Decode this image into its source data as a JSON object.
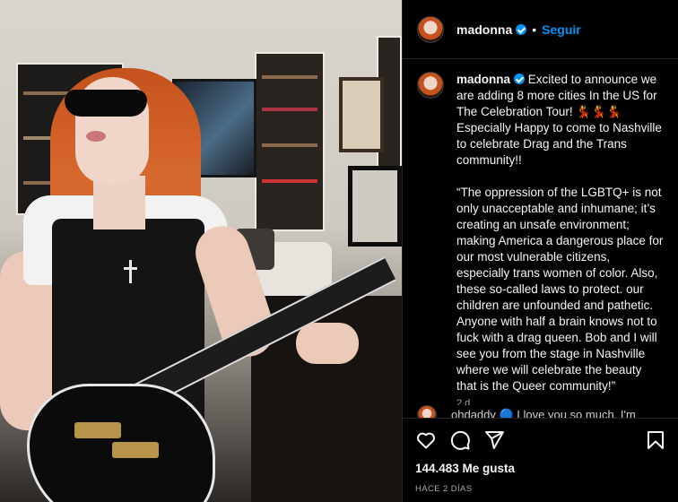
{
  "post": {
    "username": "madonna",
    "follow_label": "Seguir",
    "separator": "•",
    "caption_username": "madonna",
    "caption_text": "Excited to announce we are adding 8 more cities In the US for The Celebration Tour! 💃💃💃\nEspecially Happy to come to Nashville to celebrate Drag and the Trans community!!\n\n“The oppression of the LGBTQ+ is not only unacceptable and inhumane; it’s creating an unsafe environment; making America a dangerous place for our most vulnerable citizens, especially trans women of color.  Also, these so-called laws to protect. our children are unfounded and pathetic. Anyone with half a brain knows not to fuck with a drag queen. Bob and I will see you from the stage in Nashville where we will celebrate the beauty that is the Queer community!”",
    "time_ago": "2 d",
    "next_comment_preview": "ohdaddy 🔵 I love you so much, I'm",
    "likes": "144.483 Me gusta",
    "date": "HACE 2 DÍAS"
  },
  "icons": {
    "like": "heart-icon",
    "comment": "comment-icon",
    "share": "send-icon",
    "save": "bookmark-icon",
    "verified": "verified-badge-icon"
  },
  "colors": {
    "background": "#000000",
    "text": "#f5f5f5",
    "muted": "#a8a8a8",
    "accent": "#0095f6",
    "divider": "#262626"
  }
}
